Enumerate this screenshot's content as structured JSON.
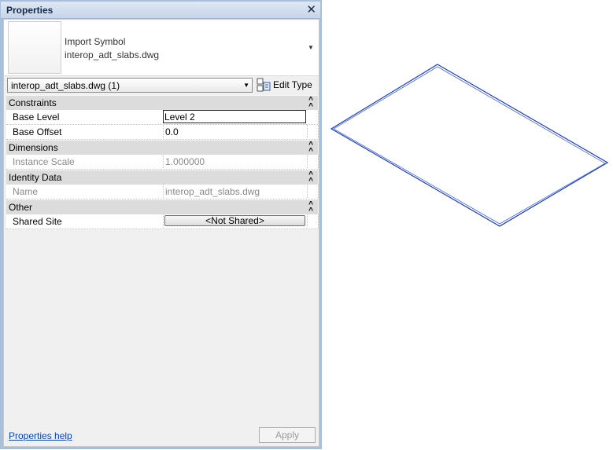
{
  "panel": {
    "title": "Properties",
    "close_icon": "close-icon"
  },
  "type_box": {
    "family": "Import Symbol",
    "type": "interop_adt_slabs.dwg"
  },
  "selector": {
    "value": "interop_adt_slabs.dwg (1)"
  },
  "edit_type": {
    "label": "Edit Type",
    "icon": "edit-type-icon"
  },
  "groups": {
    "constraints": "Constraints",
    "dimensions": "Dimensions",
    "identity": "Identity Data",
    "other": "Other"
  },
  "params": {
    "base_level": {
      "name": "Base Level",
      "value": "Level 2"
    },
    "base_offset": {
      "name": "Base Offset",
      "value": "0.0"
    },
    "instance_scale": {
      "name": "Instance Scale",
      "value": "1.000000"
    },
    "name": {
      "name": "Name",
      "value": "interop_adt_slabs.dwg"
    },
    "shared_site": {
      "name": "Shared Site",
      "value": "<Not Shared>"
    }
  },
  "footer": {
    "help": "Properties help",
    "apply": "Apply"
  },
  "colors": {
    "panel_frame": "#a9c0dd",
    "group_header": "#dcdcdc",
    "slab_line": "#1f3fa8",
    "link": "#0645ad"
  }
}
